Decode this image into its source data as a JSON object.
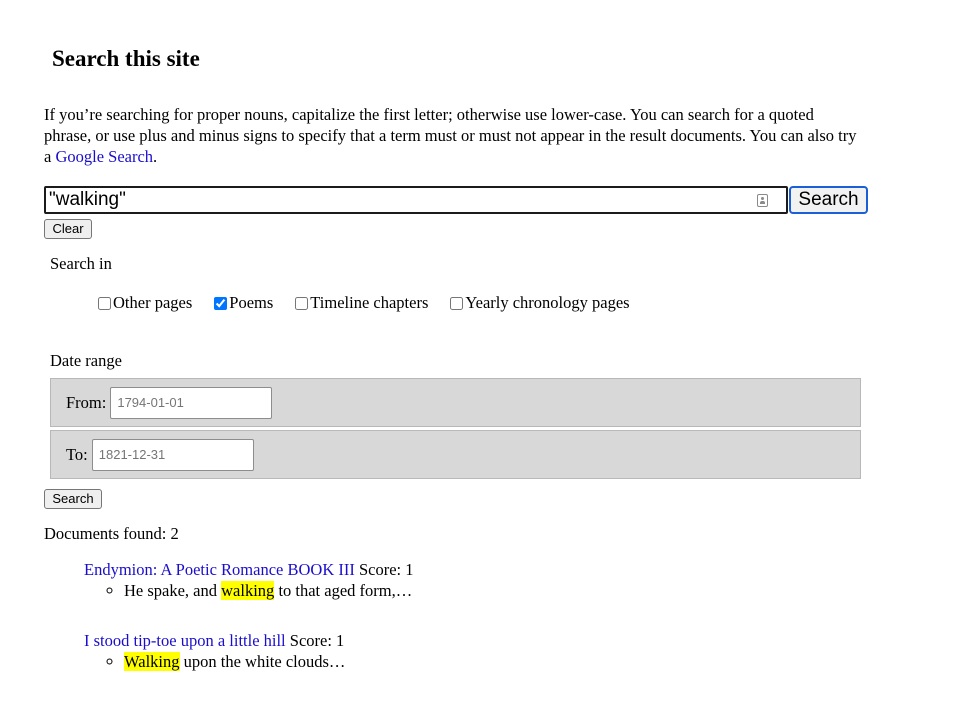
{
  "page": {
    "title": "Search this site",
    "intro": {
      "text_before": "If you’re searching for proper nouns, capitalize the first letter; otherwise use lower-case. You can search for a quoted phrase, or use plus and minus signs to specify that a term must or must not appear in the result documents. You can also try a ",
      "link_label": "Google Search",
      "text_after": "."
    }
  },
  "search": {
    "query_value": "\"walking\"",
    "search_button_label": "Search",
    "clear_button_label": "Clear"
  },
  "search_in": {
    "label": "Search in",
    "options": [
      {
        "label": "Other pages",
        "checked": false
      },
      {
        "label": "Poems",
        "checked": true
      },
      {
        "label": "Timeline chapters",
        "checked": false
      },
      {
        "label": "Yearly chronology pages",
        "checked": false
      }
    ]
  },
  "date_range": {
    "label": "Date range",
    "from_label": "From:",
    "from_placeholder": "1794-01-01",
    "to_label": "To:",
    "to_placeholder": "1821-12-31",
    "submit_label": "Search"
  },
  "results": {
    "found_text": "Documents found: 2",
    "items": [
      {
        "title": "Endymion: A Poetic Romance BOOK III",
        "score": "Score: 1",
        "snippet": {
          "before": "He spake, and ",
          "highlight": "walking",
          "after": " to that aged form,…"
        }
      },
      {
        "title": "I stood tip-toe upon a little hill",
        "score": "Score: 1",
        "snippet": {
          "before": "",
          "highlight": "Walking",
          "after": " upon the white clouds…"
        }
      }
    ]
  },
  "icons": {
    "query_field_icon": "contact-card-icon"
  },
  "colors": {
    "link": "#1a0dcc",
    "highlight": "#ffff00",
    "focus_border": "#1a5fd6",
    "date_row_background": "#d8d8d8"
  }
}
